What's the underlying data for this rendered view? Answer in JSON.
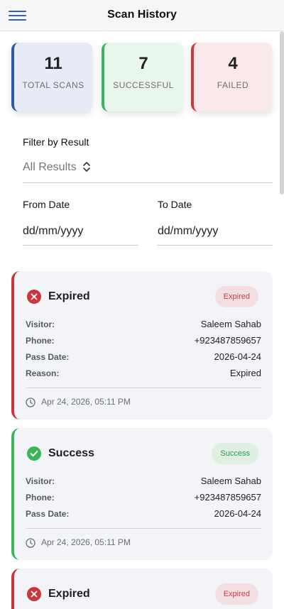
{
  "header": {
    "title": "Scan History",
    "menu_icon": "hamburger-menu-icon"
  },
  "stats": {
    "total": {
      "value": "11",
      "label": "TOTAL SCANS",
      "color": "#2a59a8"
    },
    "successful": {
      "value": "7",
      "label": "SUCCESSFUL",
      "color": "#3bb55b"
    },
    "failed": {
      "value": "4",
      "label": "FAILED",
      "color": "#cc3a3f"
    }
  },
  "filter": {
    "result_label": "Filter by Result",
    "result_value": "All Results",
    "from_label": "From Date",
    "from_placeholder": "dd/mm/yyyy",
    "to_label": "To Date",
    "to_placeholder": "dd/mm/yyyy"
  },
  "scans": [
    {
      "status": "Expired",
      "badge": "Expired",
      "result": "failed",
      "icon": "x-circle-icon",
      "visitor_label": "Visitor:",
      "visitor": "Saleem Sahab",
      "phone_label": "Phone:",
      "phone": "+923487859657",
      "pass_date_label": "Pass Date:",
      "pass_date": "2026-04-24",
      "reason_label": "Reason:",
      "reason": "Expired",
      "timestamp": "Apr 24, 2026, 05:11 PM"
    },
    {
      "status": "Success",
      "badge": "Success",
      "result": "success",
      "icon": "check-circle-icon",
      "visitor_label": "Visitor:",
      "visitor": "Saleem Sahab",
      "phone_label": "Phone:",
      "phone": "+923487859657",
      "pass_date_label": "Pass Date:",
      "pass_date": "2026-04-24",
      "timestamp": "Apr 24, 2026, 05:11 PM"
    },
    {
      "status": "Expired",
      "badge": "Expired",
      "result": "failed",
      "icon": "x-circle-icon"
    }
  ],
  "colors": {
    "failed": "#c9363b",
    "success": "#3bb55b",
    "accent": "#3461b8"
  }
}
